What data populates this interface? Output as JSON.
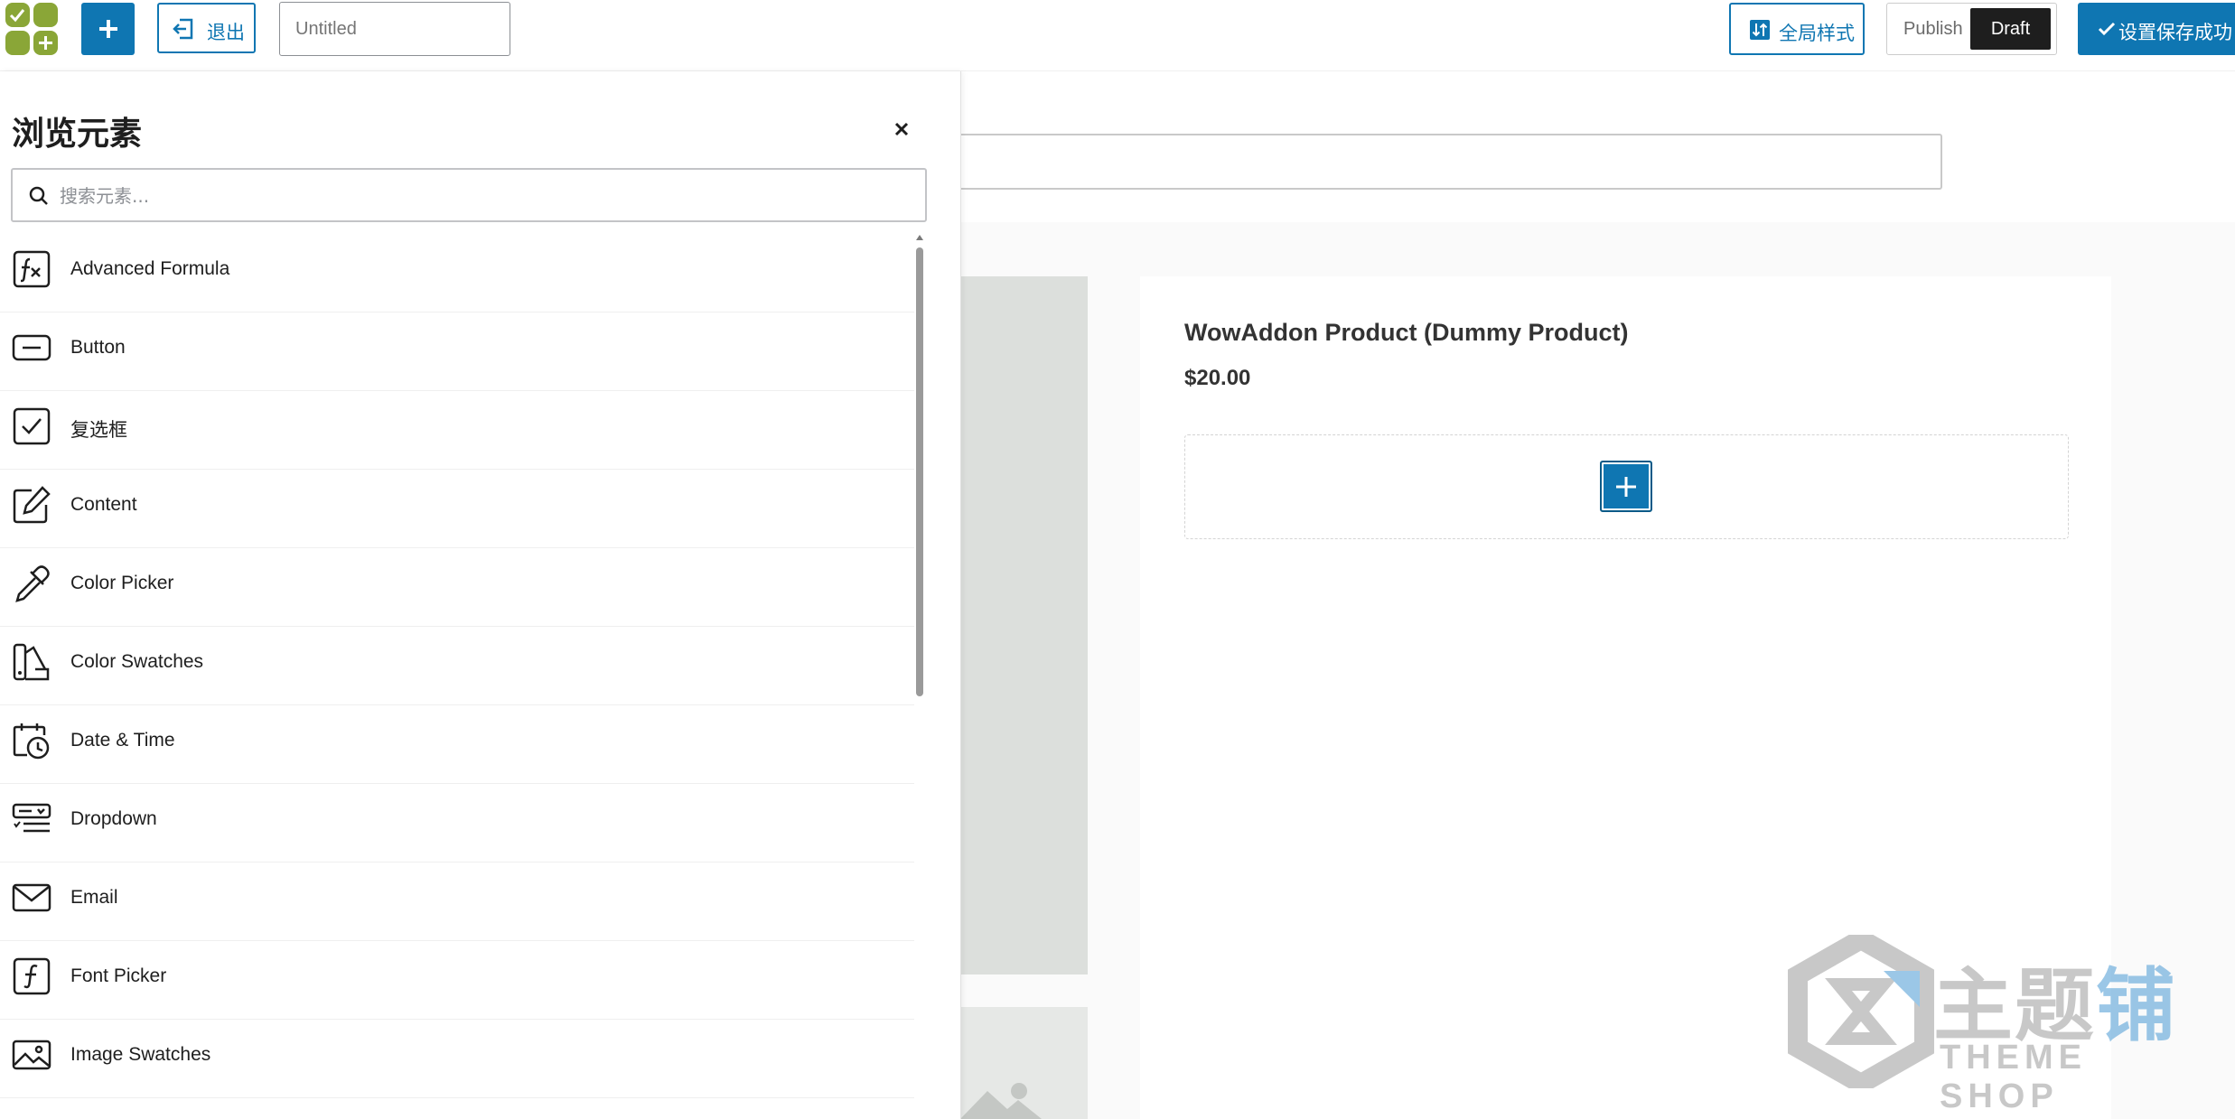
{
  "toolbar": {
    "exit_label": "退出",
    "title_placeholder": "Untitled",
    "global_style_label": "全局样式",
    "publish_label": "Publish",
    "draft_label": "Draft",
    "save_label": "设置保存成功"
  },
  "panel": {
    "title": "浏览元素",
    "search_placeholder": "搜索元素...",
    "items": [
      {
        "label": "Advanced Formula",
        "icon": "formula-icon"
      },
      {
        "label": "Button",
        "icon": "button-icon"
      },
      {
        "label": "复选框",
        "icon": "checkbox-icon"
      },
      {
        "label": "Content",
        "icon": "edit-icon"
      },
      {
        "label": "Color Picker",
        "icon": "eyedropper-icon"
      },
      {
        "label": "Color Swatches",
        "icon": "swatches-icon"
      },
      {
        "label": "Date & Time",
        "icon": "calendar-clock-icon"
      },
      {
        "label": "Dropdown",
        "icon": "dropdown-icon"
      },
      {
        "label": "Email",
        "icon": "email-icon"
      },
      {
        "label": "Font Picker",
        "icon": "font-icon"
      },
      {
        "label": "Image Swatches",
        "icon": "image-icon"
      }
    ]
  },
  "product": {
    "title": "WowAddon Product (Dummy Product)",
    "price": "$20.00"
  },
  "watermark": {
    "cn_text_1": "主题",
    "cn_text_2": "铺",
    "en_text": "THEME SHOP"
  },
  "colors": {
    "accent": "#0f76b2",
    "logo_green": "#8aa637",
    "dark": "#1e1e1e"
  }
}
